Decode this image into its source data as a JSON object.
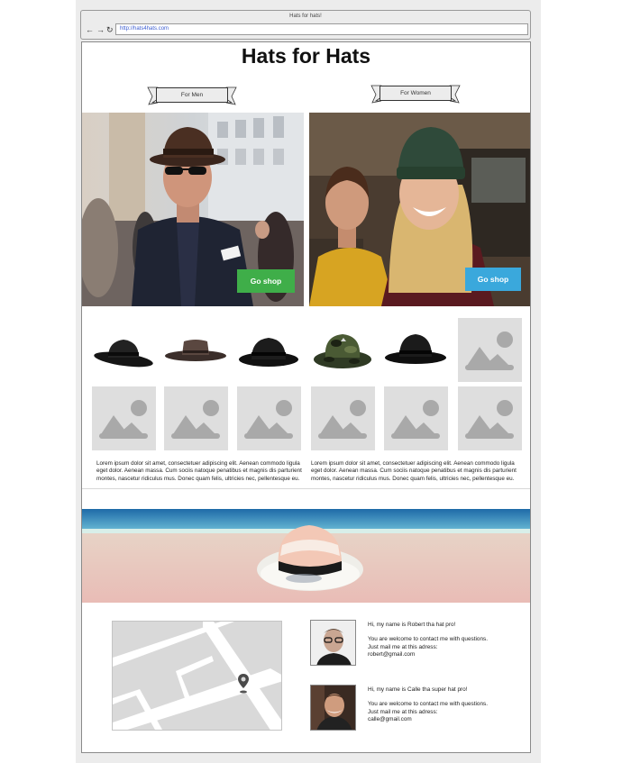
{
  "browser": {
    "window_title": "Hats for hats!",
    "url": "http://hats4hats.com",
    "nav": {
      "back": "←",
      "forward": "→",
      "reload": "↻"
    }
  },
  "page": {
    "title": "Hats for Hats",
    "sections": [
      {
        "ribbon_label": "For Men",
        "button_label": "Go shop",
        "button_color": "#3fae49"
      },
      {
        "ribbon_label": "For Women",
        "button_label": "Go shop",
        "button_color": "#3aa8dc"
      }
    ],
    "lorem": [
      "Lorem ipsum dolor sit amet, consectetuer adipiscing elit. Aenean commodo ligula eget dolor. Aenean massa. Cum sociis natoque penatibus et magnis dis parturient montes, nascetur ridiculus mus. Donec quam felis, ultricies nec, pellentesque eu.",
      "Lorem ipsum dolor sit amet, consectetuer adipiscing elit. Aenean commodo ligula eget dolor. Aenean massa. Cum sociis natoque penatibus et magnis dis parturient montes, nascetur ridiculus mus. Donec quam felis, ultricies nec, pellentesque eu."
    ],
    "contacts": [
      {
        "greeting": "Hi, my name is Robert tha hat pro!",
        "line1": "You are welcome to contact me with questions.",
        "line2": "Just mail me at this adress:",
        "email": "robert@gmail.com"
      },
      {
        "greeting": "Hi, my name is Calle tha super hat pro!",
        "line1": "You are welcome to contact me with questions.",
        "line2": "Just mail me at this adress:",
        "email": "calle@gmail.com"
      }
    ]
  }
}
